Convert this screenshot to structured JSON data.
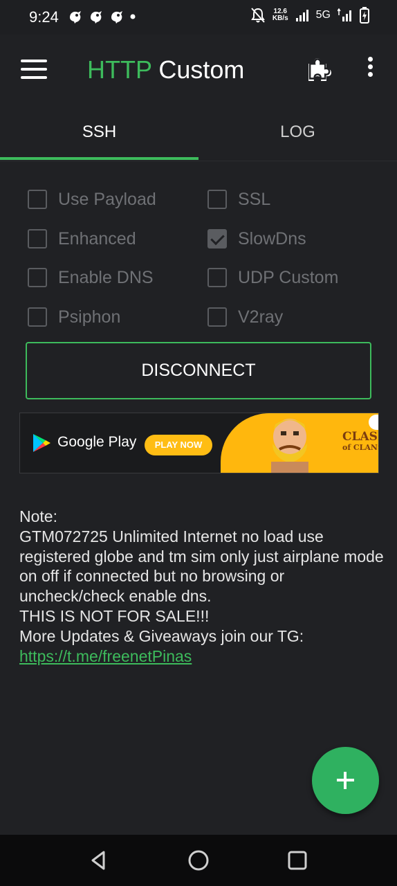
{
  "status_bar": {
    "time": "9:24",
    "network_speed_value": "12.6",
    "network_speed_unit": "KB/s",
    "network_type": "5G"
  },
  "app_bar": {
    "title_part1": "HTTP",
    "title_part2": "Custom",
    "accent_color": "#3dbb5c"
  },
  "tabs": [
    {
      "label": "SSH",
      "selected": true
    },
    {
      "label": "LOG",
      "selected": false
    }
  ],
  "options": {
    "use_payload": {
      "label": "Use Payload",
      "checked": false
    },
    "ssl": {
      "label": "SSL",
      "checked": false
    },
    "enhanced": {
      "label": "Enhanced",
      "checked": false
    },
    "slowdns": {
      "label": "SlowDns",
      "checked": true
    },
    "enable_dns": {
      "label": "Enable DNS",
      "checked": false
    },
    "udp_custom": {
      "label": "UDP Custom",
      "checked": false
    },
    "psiphon": {
      "label": "Psiphon",
      "checked": false
    },
    "v2ray": {
      "label": "V2ray",
      "checked": false
    }
  },
  "disconnect_button": {
    "label": "DISCONNECT"
  },
  "ad": {
    "store_label": "Google Play",
    "cta_label": "PLAY NOW",
    "game_title_line1": "CLASH",
    "game_title_line2": "of CLANS"
  },
  "note": {
    "heading": "Note:",
    "body": "GTM072725 Unlimited Internet no load use registered globe and tm sim only just airplane mode on off if connected but no browsing or uncheck/check enable dns.",
    "warning": "THIS IS NOT FOR SALE!!!",
    "updates": "More Updates & Giveaways join our TG:",
    "link": "https://t.me/freenetPinas"
  },
  "fab": {
    "icon": "plus-icon"
  }
}
